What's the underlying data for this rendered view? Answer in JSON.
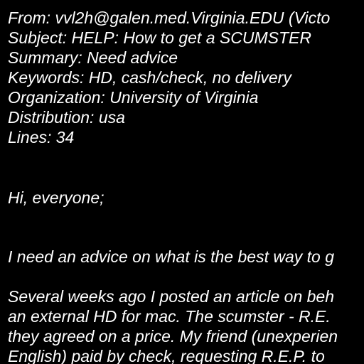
{
  "colors": {
    "background": "#000000",
    "text": "#ffffff"
  },
  "header": {
    "from": "From: vvl2h@galen.med.Virginia.EDU (Victo",
    "subject": "Subject: HELP: How to get a SCUMSTER",
    "summary": "Summary: Need advice",
    "keywords": "Keywords: HD, cash/check, no delivery",
    "organization": "Organization: University of Virginia",
    "distribution": "Distribution: usa",
    "lines": "Lines: 34"
  },
  "body": {
    "greeting": "Hi, everyone;",
    "line1": "I need an advice on what is the best way to g",
    "para2": [
      "Several weeks ago I posted an article on beh",
      "an external HD for mac. The scumster - R.E.",
      "they agreed on a price. My friend (unexperien",
      "English) paid by check, requesting R.E.P. to"
    ]
  }
}
